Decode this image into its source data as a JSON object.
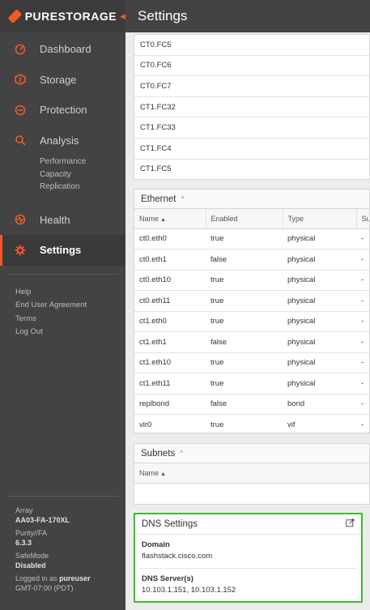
{
  "brand": {
    "logo_text": "PURESTORAGE",
    "accent": "#f15a24"
  },
  "header": {
    "title": "Settings"
  },
  "sidebar": {
    "items": [
      {
        "label": "Dashboard",
        "icon": "dashboard-icon"
      },
      {
        "label": "Storage",
        "icon": "storage-icon"
      },
      {
        "label": "Protection",
        "icon": "protection-icon"
      },
      {
        "label": "Analysis",
        "icon": "analysis-icon"
      },
      {
        "label": "Health",
        "icon": "health-icon"
      },
      {
        "label": "Settings",
        "icon": "gear-icon",
        "active": true
      }
    ],
    "analysis_sub": [
      "Performance",
      "Capacity",
      "Replication"
    ],
    "links": [
      "Help",
      "End User Agreement",
      "Terms",
      "Log Out"
    ],
    "info": {
      "array_label": "Array",
      "array_value": "AA03-FA-170XL",
      "purity_label": "Purity//FA",
      "purity_value": "6.3.3",
      "safemode_label": "SafeMode",
      "safemode_value": "Disabled",
      "logged_prefix": "Logged in as",
      "logged_user": "pureuser",
      "timezone": "GMT-07:00 (PDT)"
    }
  },
  "fc_ports": [
    "CT0.FC5",
    "CT0.FC6",
    "CT0.FC7",
    "CT1.FC32",
    "CT1.FC33",
    "CT1.FC4",
    "CT1.FC5"
  ],
  "ethernet": {
    "title": "Ethernet",
    "columns": [
      "Name",
      "Enabled",
      "Type",
      "Su"
    ],
    "rows": [
      [
        "ct0.eth0",
        "true",
        "physical",
        "-"
      ],
      [
        "ct0.eth1",
        "false",
        "physical",
        "-"
      ],
      [
        "ct0.eth10",
        "true",
        "physical",
        "-"
      ],
      [
        "ct0.eth11",
        "true",
        "physical",
        "-"
      ],
      [
        "ct1.eth0",
        "true",
        "physical",
        "-"
      ],
      [
        "ct1.eth1",
        "false",
        "physical",
        "-"
      ],
      [
        "ct1.eth10",
        "true",
        "physical",
        "-"
      ],
      [
        "ct1.eth11",
        "true",
        "physical",
        "-"
      ],
      [
        "replbond",
        "false",
        "bond",
        "-"
      ],
      [
        "vir0",
        "true",
        "vif",
        "-"
      ]
    ]
  },
  "subnets": {
    "title": "Subnets",
    "columns": [
      "Name"
    ]
  },
  "dns": {
    "title": "DNS Settings",
    "domain_label": "Domain",
    "domain_value": "flashstack.cisco.com",
    "servers_label": "DNS Server(s)",
    "servers_value": "10.103.1.151, 10.103.1.152"
  }
}
